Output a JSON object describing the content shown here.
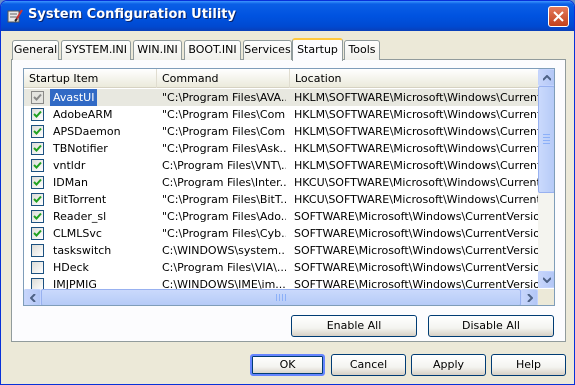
{
  "window": {
    "title": "System Configuration Utility",
    "icon": "msconfig-icon"
  },
  "tabs": [
    "General",
    "SYSTEM.INI",
    "WIN.INI",
    "BOOT.INI",
    "Services",
    "Startup",
    "Tools"
  ],
  "active_tab": "Startup",
  "list": {
    "columns": [
      "Startup Item",
      "Command",
      "Location"
    ],
    "rows": [
      {
        "checked": true,
        "item": "AvastUI",
        "command": "\"C:\\Program Files\\AVA...",
        "location": "HKLM\\SOFTWARE\\Microsoft\\Windows\\CurrentVer..."
      },
      {
        "checked": true,
        "item": "AdobeARM",
        "command": "\"C:\\Program Files\\Com...",
        "location": "HKLM\\SOFTWARE\\Microsoft\\Windows\\CurrentVer..."
      },
      {
        "checked": true,
        "item": "APSDaemon",
        "command": "\"C:\\Program Files\\Com...",
        "location": "HKLM\\SOFTWARE\\Microsoft\\Windows\\CurrentVer..."
      },
      {
        "checked": true,
        "item": "TBNotifier",
        "command": "\"C:\\Program Files\\Ask...",
        "location": "HKLM\\SOFTWARE\\Microsoft\\Windows\\CurrentVer..."
      },
      {
        "checked": true,
        "item": "vntldr",
        "command": "C:\\Program Files\\VNT\\...",
        "location": "HKLM\\SOFTWARE\\Microsoft\\Windows\\CurrentVer..."
      },
      {
        "checked": true,
        "item": "IDMan",
        "command": "C:\\Program Files\\Inter...",
        "location": "HKCU\\SOFTWARE\\Microsoft\\Windows\\CurrentVer..."
      },
      {
        "checked": true,
        "item": "BitTorrent",
        "command": "\"C:\\Program Files\\BitT...",
        "location": "HKCU\\SOFTWARE\\Microsoft\\Windows\\CurrentVer..."
      },
      {
        "checked": true,
        "item": "Reader_sl",
        "command": "\"C:\\Program Files\\Ado...",
        "location": "SOFTWARE\\Microsoft\\Windows\\CurrentVersion\\Ru..."
      },
      {
        "checked": true,
        "item": "CLMLSvc",
        "command": "\"C:\\Program Files\\Cyb...",
        "location": "SOFTWARE\\Microsoft\\Windows\\CurrentVersion\\Ru..."
      },
      {
        "checked": false,
        "item": "taskswitch",
        "command": "C:\\WINDOWS\\system...",
        "location": "SOFTWARE\\Microsoft\\Windows\\CurrentVersion\\Ru..."
      },
      {
        "checked": false,
        "item": "HDeck",
        "command": "C:\\Program Files\\VIA\\...",
        "location": "SOFTWARE\\Microsoft\\Windows\\CurrentVersion\\Ru..."
      },
      {
        "checked": false,
        "item": "IMJPMIG",
        "command": "C:\\WINDOWS\\IME\\im...",
        "location": "SOFTWARE\\Microsoft\\Windows\\CurrentVersion\\Ru..."
      }
    ],
    "selected_index": 0
  },
  "buttons": {
    "enable_all": "Enable All",
    "disable_all": "Disable All",
    "ok": "OK",
    "cancel": "Cancel",
    "apply": "Apply",
    "help": "Help"
  },
  "colors": {
    "titlebar": "#0053e0",
    "selection": "#316ac5",
    "checkmark": "#21a121",
    "tab_highlight": "#ffc83c"
  }
}
